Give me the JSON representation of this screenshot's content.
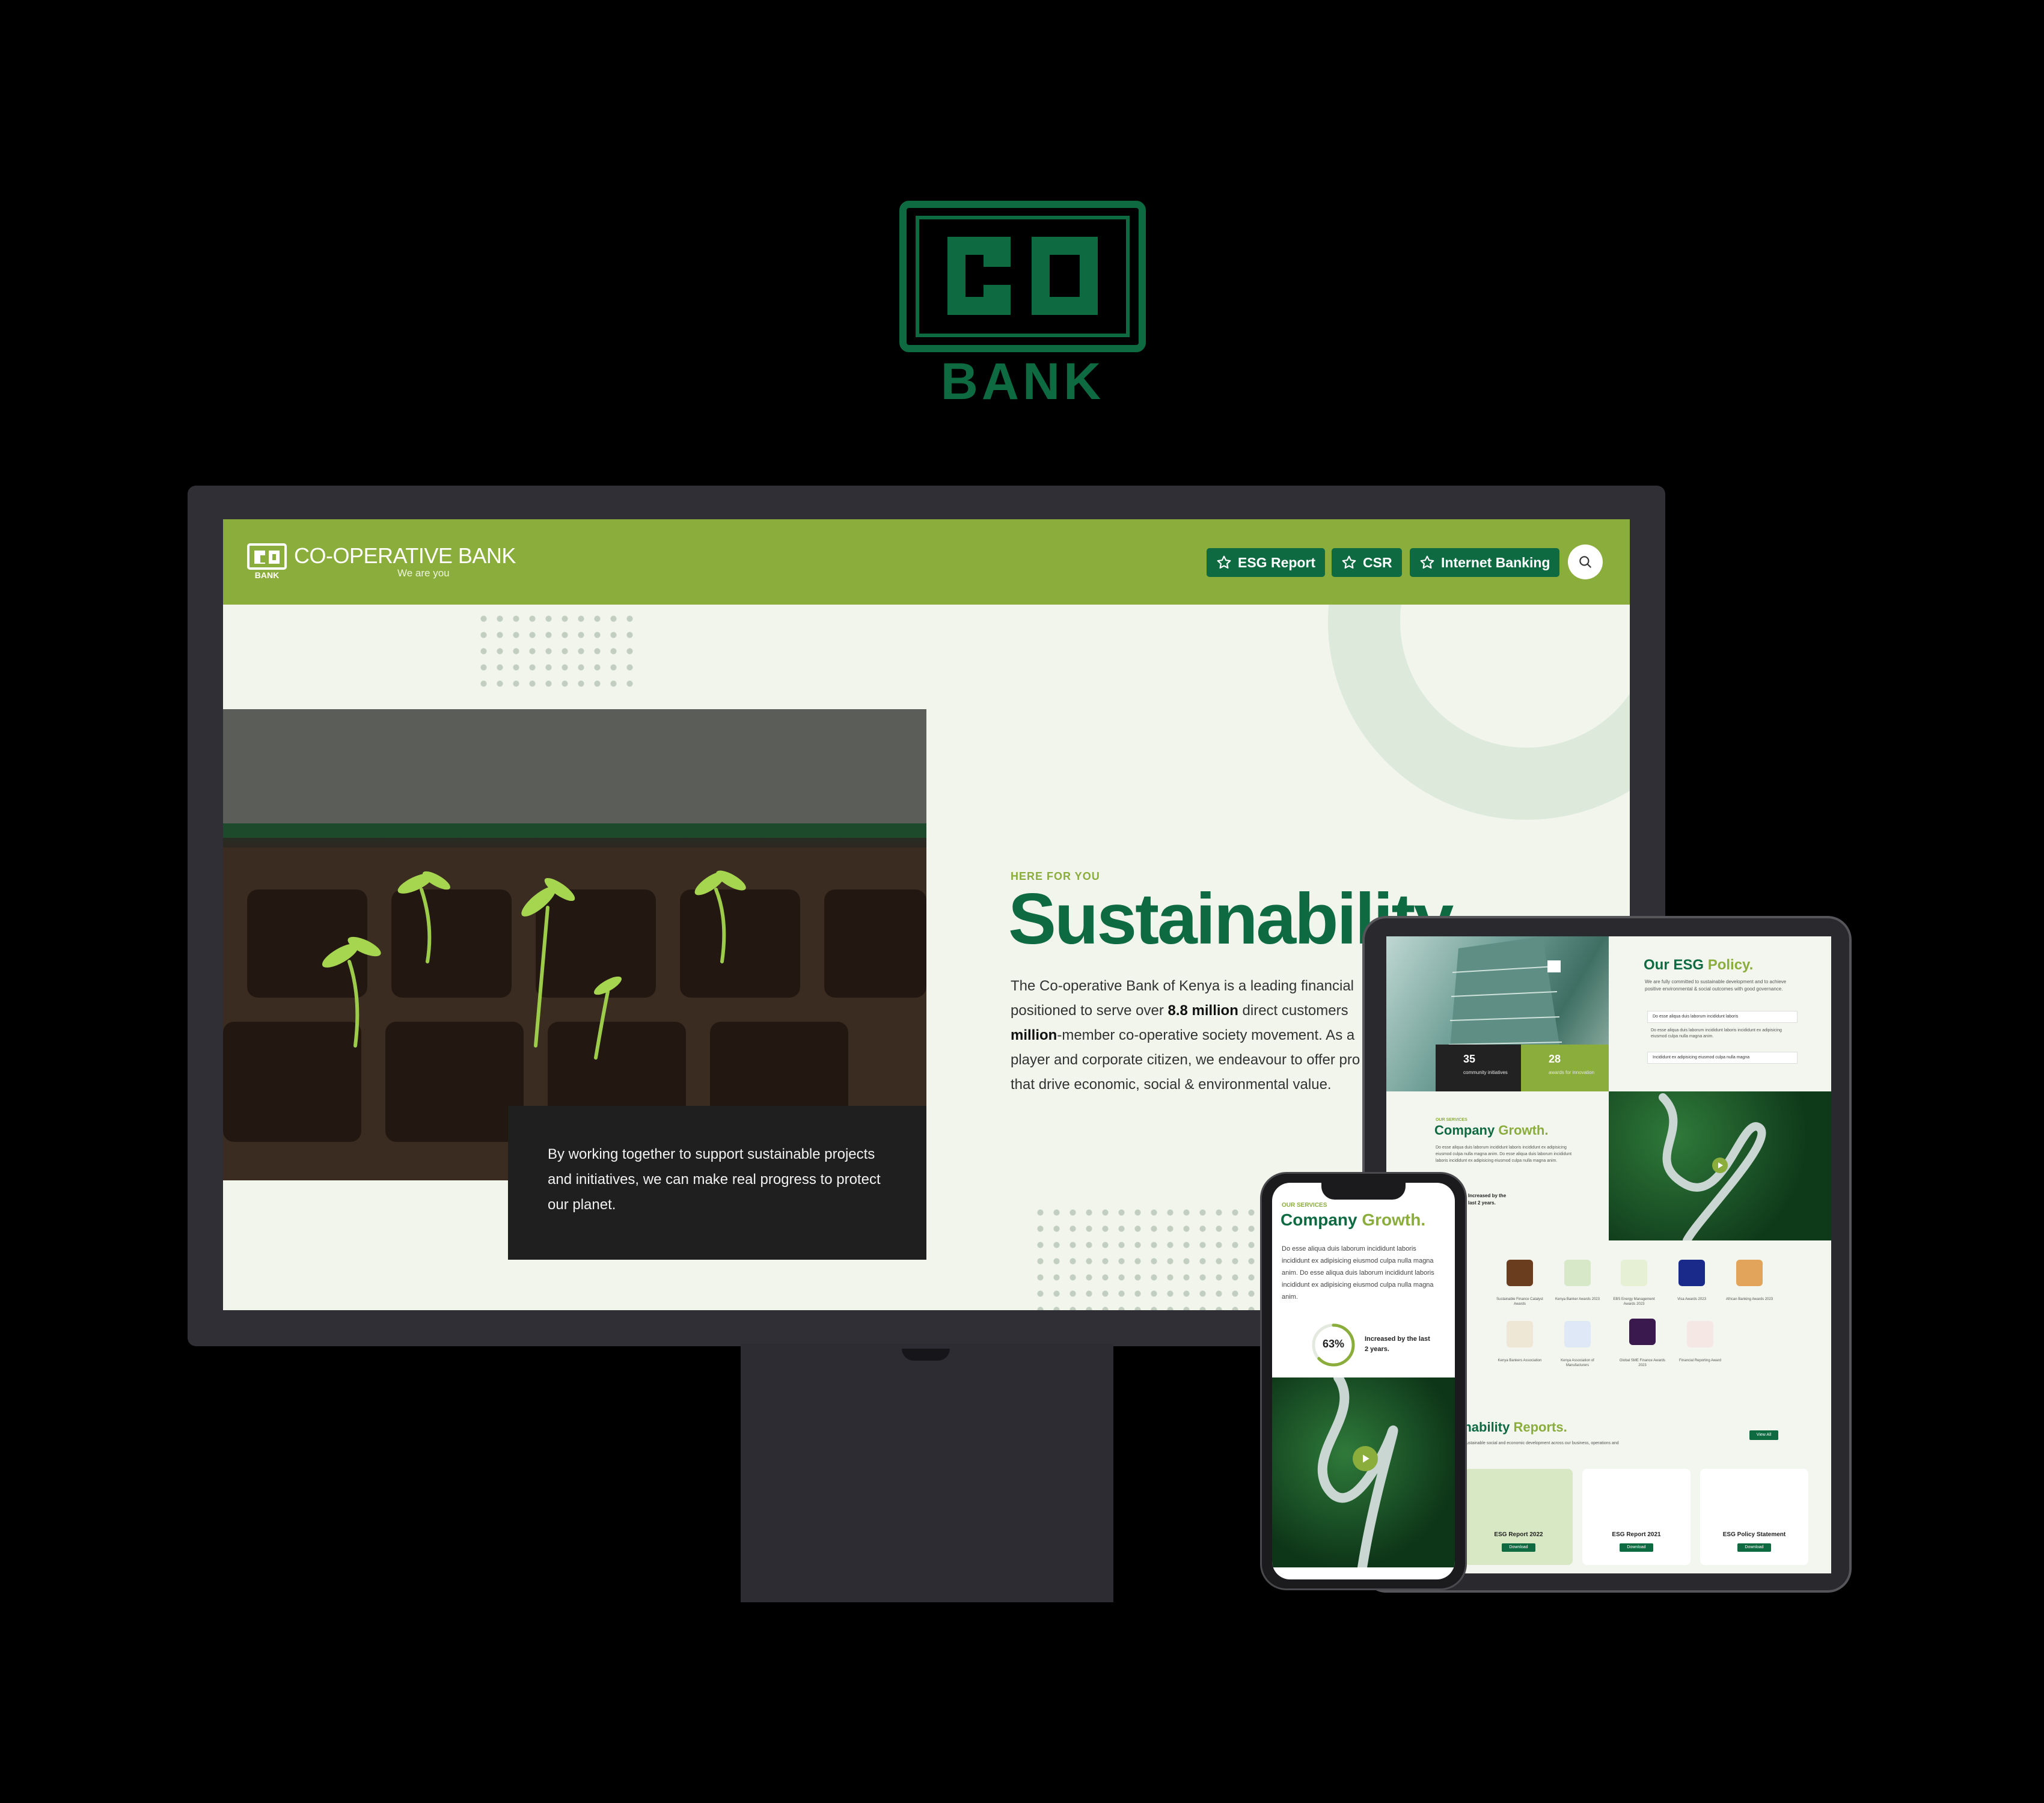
{
  "logo": {
    "mark": "CO",
    "word": "BANK",
    "color": "#0e6a41"
  },
  "desktop": {
    "nav": {
      "brand": "CO-OPERATIVE BANK",
      "tagline": "We are you",
      "buttons": [
        {
          "label": "ESG Report",
          "icon": "star-icon"
        },
        {
          "label": "CSR",
          "icon": "star-icon"
        },
        {
          "label": "Internet Banking",
          "icon": "star-icon"
        }
      ],
      "search_icon": "search-icon"
    },
    "quote": "By working together to support sustainable projects and initiatives, we can make real progress to protect our planet.",
    "eyebrow": "HERE FOR YOU",
    "title": "Sustainability",
    "copy": {
      "p1": "The Co-operative Bank of Kenya is a leading financial",
      "p2": "positioned to serve over ",
      "b1": "8.8 million",
      "p3": " direct customers",
      "b2": "million",
      "p4": "-member co-operative society movement. As a",
      "p5": "player and corporate citizen, we endeavour to offer pro",
      "p6": "that drive economic, social & environmental value."
    }
  },
  "tablet": {
    "stats": [
      {
        "value": "35",
        "label": "community initiatives"
      },
      {
        "value": "28",
        "label": "awards for innovation"
      }
    ],
    "policy_title": "Our ESG",
    "policy_title_accent": "Policy.",
    "policy_copy": "We are fully committed to sustainable development and to achieve positive environmental & social outcomes with good governance.",
    "accordion": [
      "Do esse aliqua duis laborum incididunt laboris",
      "Incididunt ex adipisicing eiusmod culpa nulla magna"
    ],
    "accordion_body": "Do esse aliqua duis laborum incididunt laboris incididunt ex adipisicing eiusmod culpa nulla magna anim.",
    "growth_eyebrow": "OUR SERVICES",
    "growth_title": "Company",
    "growth_title_accent": "Growth.",
    "growth_copy": "Do esse aliqua duis laborum incididunt laboris incididunt ex adipisicing eiusmod culpa nulla magna anim. Do esse aliqua duis laborum incididunt laboris incididunt ex adipisicing eiusmod culpa nulla magna anim.",
    "growth_inc": "Increased by the last 2 years.",
    "awards": [
      "Sustainable Finance Catalyst Awards",
      "Kenya Banker Awards 2023",
      "EBS Energy Management Awards 2023",
      "Visa Awards 2023",
      "African Banking Awards 2023",
      "Kenya Bankers Association",
      "Kenya Association of Manufacturers",
      "Global SME Finance Awards 2023",
      "Financial Reporting Award"
    ],
    "reports_title": "ainability",
    "reports_title_accent": "Reports.",
    "reports_copy": "ted to sustainable social and economic development across our business, operations and",
    "view_all": "View All",
    "reports": [
      {
        "title": "ESG Report 2022",
        "button": "Download"
      },
      {
        "title": "ESG Report 2021",
        "button": "Download"
      },
      {
        "title": "ESG Policy Statement",
        "button": "Download"
      }
    ]
  },
  "phone": {
    "eyebrow": "OUR SERVICES",
    "title": "Company",
    "title_accent": "Growth.",
    "copy": "Do esse aliqua duis laborum incididunt laboris incididunt ex adipisicing eiusmod culpa nulla magna anim. Do esse aliqua duis laborum incididunt laboris incididunt ex adipisicing eiusmod culpa nulla magna anim.",
    "percent_label": "63%",
    "percent_value": 0.63,
    "increase": "Increased by the last 2 years.",
    "play_icon": "play-icon"
  },
  "colors": {
    "brand_green": "#0e6a41",
    "lime": "#8aad3b",
    "background": "#000000"
  }
}
